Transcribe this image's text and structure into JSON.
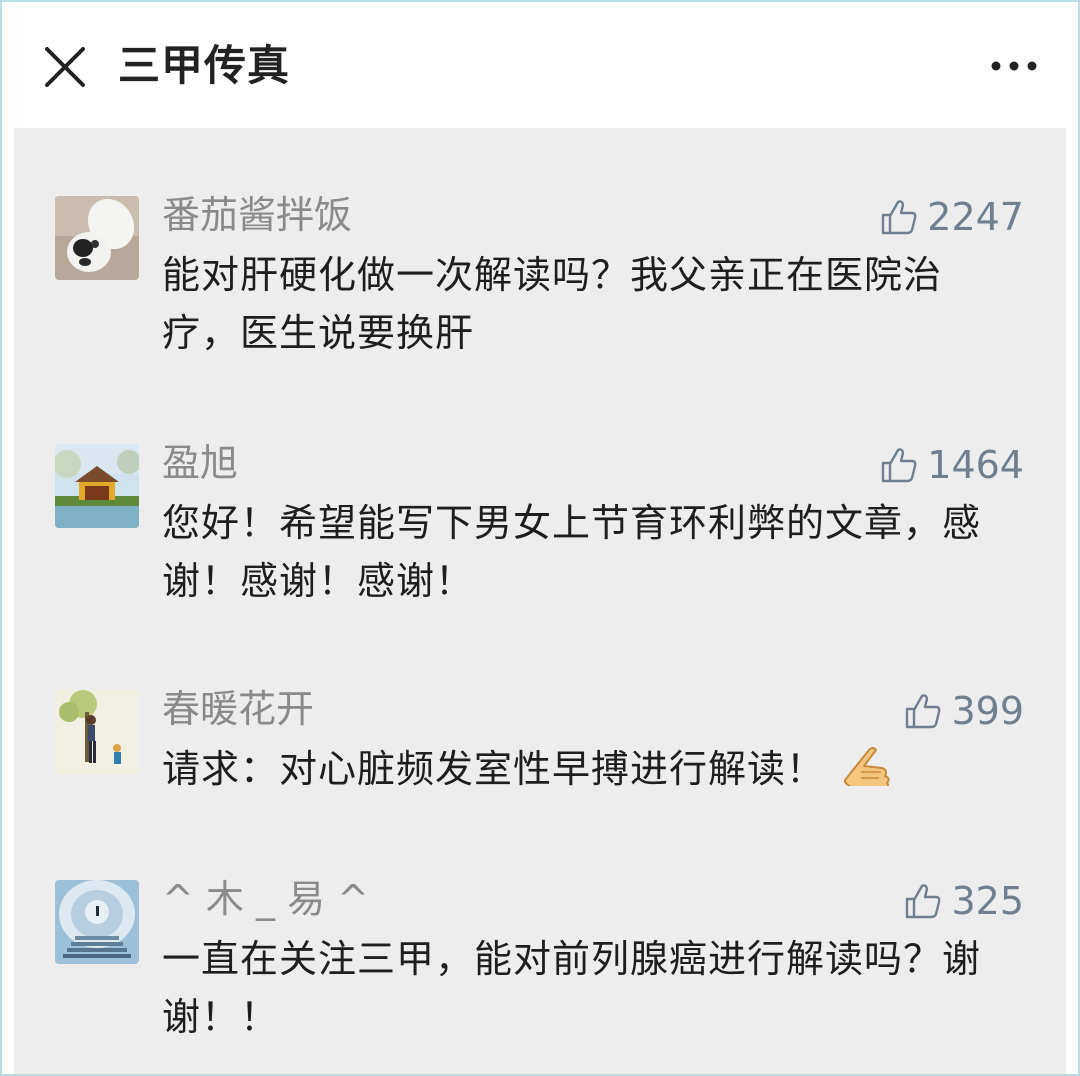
{
  "header": {
    "title": "三甲传真",
    "close_icon": "close-icon",
    "more_icon": "more-icon"
  },
  "comments": [
    {
      "nickname": "番茄酱拌饭",
      "likes": "2247",
      "text": "能对肝硬化做一次解读吗？我父亲正在医院治疗，医生说要换肝",
      "avatar": "dog-avatar"
    },
    {
      "nickname": "盈旭",
      "likes": "1464",
      "text": "您好！希望能写下男女上节育环利弊的文章，感谢！感谢！感谢！",
      "avatar": "pavilion-avatar"
    },
    {
      "nickname": "春暖花开",
      "likes": "399",
      "text": "请求：对心脏频发室性早搏进行解读！",
      "emoji": "pointing-hand-emoji",
      "avatar": "family-tree-avatar"
    },
    {
      "nickname": "^ 木 _ 易 ^",
      "likes": "325",
      "text": "一直在关注三甲，能对前列腺癌进行解读吗？谢谢！！",
      "avatar": "stairs-avatar"
    }
  ],
  "colors": {
    "background": "#ededed",
    "nickname": "#8a8a8a",
    "like": "#6f7f8f",
    "text": "#1e1e1e"
  }
}
